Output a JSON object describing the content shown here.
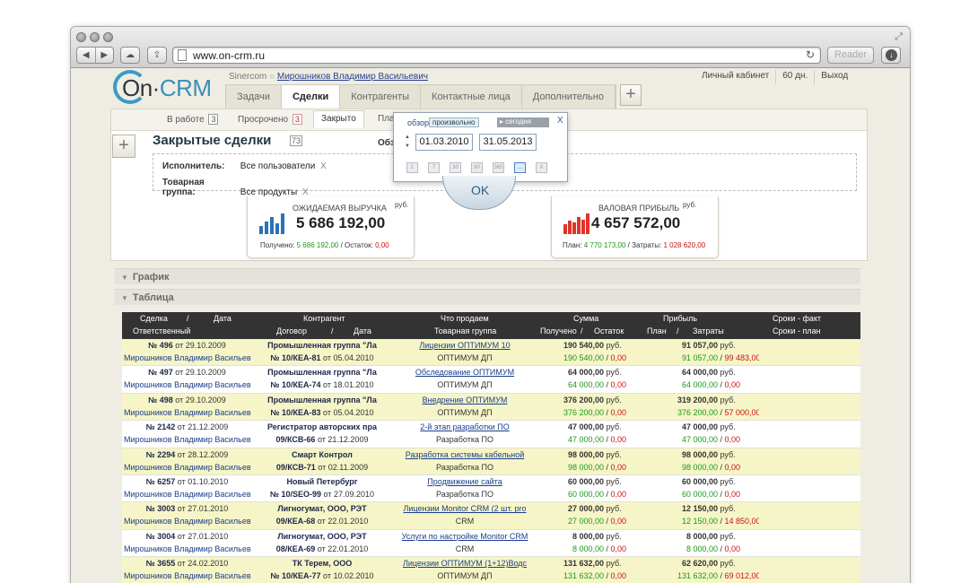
{
  "browser": {
    "url": "www.on-crm.ru",
    "reader_label": "Reader"
  },
  "app": {
    "logo_text": "On·CRM",
    "company": "Sinercom",
    "user_name": "Мирошников Владимир Васильевич",
    "right_links": [
      "Личный кабинет",
      "60 дн.",
      "Выход"
    ],
    "nav_tabs": [
      {
        "label": "Задачи",
        "active": false
      },
      {
        "label": "Сделки",
        "active": true
      },
      {
        "label": "Контрагенты",
        "active": false
      },
      {
        "label": "Контактные лица",
        "active": false
      },
      {
        "label": "Дополнительно",
        "active": false
      }
    ],
    "plus_label": "+"
  },
  "subtabs": [
    {
      "label": "В работе",
      "count": "3",
      "active": false,
      "red": false
    },
    {
      "label": "Просрочено",
      "count": "3",
      "active": false,
      "red": true
    },
    {
      "label": "Закрыто",
      "count": "",
      "active": true,
      "red": false
    },
    {
      "label": "Пла",
      "count": "",
      "active": false,
      "red": false
    }
  ],
  "page": {
    "title": "Закрытые сделки",
    "title_count": "73",
    "obzor_label": "Обз"
  },
  "filters": [
    {
      "label": "Исполнитель:",
      "value": "Все пользователи",
      "remove": "X"
    },
    {
      "label": "Товарная группа:",
      "value": "Все продукты",
      "remove": "X"
    }
  ],
  "date_picker": {
    "label": "обзор:",
    "mode": "произвольно",
    "today_label": "сегодня",
    "close_label": "X",
    "date_from": "01.03.2010",
    "date_to": "31.05.2013",
    "icons": [
      "1",
      "7",
      "30",
      "90",
      "365",
      "...",
      "X"
    ],
    "active_icon_index": 5,
    "ok_label": "OK"
  },
  "kpis": {
    "revenue": {
      "title": "ОЖИДАЕМАЯ ВЫРУЧКА",
      "currency": "руб.",
      "value": "5 686 192,00",
      "sub_label1": "Получено: ",
      "sub_value1": "5 686 192,00",
      "sub_label2": " / Остаток: ",
      "sub_value2": "0,00"
    },
    "profit": {
      "title": "ВАЛОВАЯ ПРИБЫЛЬ",
      "currency": "руб.",
      "value": "4 657 572,00",
      "sub_label1": "План: ",
      "sub_value1": "4 770 173,00",
      "sub_label2": " / Затраты: ",
      "sub_value2": "1 028 620,00"
    }
  },
  "sections": {
    "chart": "График",
    "table": "Таблица"
  },
  "table": {
    "header_row1": [
      "Сделка",
      "/",
      "Дата",
      "Контрагент",
      "Что продаем",
      "Сумма",
      "Прибыль",
      "Сроки - факт"
    ],
    "header_row2": [
      "Ответственный",
      "Договор",
      "/",
      "Дата",
      "Товарная группа",
      "Получено",
      "/",
      "Остаток",
      "План",
      "/",
      "Затраты",
      "Сроки - план"
    ],
    "rows": [
      {
        "deal": "№ 496",
        "date_prefix": "от",
        "date": "29.10.2009",
        "owner": "Мирошников Владимир Васильев",
        "client": "Промышленная группа \"Ла",
        "contract": "№ 10/КЕА-81",
        "contract_date_prefix": "от",
        "contract_date": "05.04.2010",
        "product": "Лицензии ОПТИМУМ 10",
        "group": "ОПТИМУМ ДП",
        "sum": "190 540,00",
        "received": "190 540,00",
        "remain": "0,00",
        "profit": "91 057,00",
        "plan": "91 057,00",
        "costs": "99 483,00",
        "currency": "руб."
      },
      {
        "deal": "№ 497",
        "date_prefix": "от",
        "date": "29.10.2009",
        "owner": "Мирошников Владимир Васильев",
        "client": "Промышленная группа \"Ла",
        "contract": "№ 10/КЕА-74",
        "contract_date_prefix": "от",
        "contract_date": "18.01.2010",
        "product": "Обследование ОПТИМУМ",
        "group": "ОПТИМУМ ДП",
        "sum": "64 000,00",
        "received": "64 000,00",
        "remain": "0,00",
        "profit": "64 000,00",
        "plan": "64 000,00",
        "costs": "0,00",
        "currency": "руб."
      },
      {
        "deal": "№ 498",
        "date_prefix": "от",
        "date": "29.10.2009",
        "owner": "Мирошников Владимир Васильев",
        "client": "Промышленная группа \"Ла",
        "contract": "№ 10/КЕА-83",
        "contract_date_prefix": "от",
        "contract_date": "05.04.2010",
        "product": "Внедрение ОПТИМУМ",
        "group": "ОПТИМУМ ДП",
        "sum": "376 200,00",
        "received": "376 200,00",
        "remain": "0,00",
        "profit": "319 200,00",
        "plan": "376 200,00",
        "costs": "57 000,00",
        "currency": "руб."
      },
      {
        "deal": "№ 2142",
        "date_prefix": "от",
        "date": "21.12.2009",
        "owner": "Мирошников Владимир Васильев",
        "client": "Регистратор авторских пра",
        "contract": "09/КСВ-66",
        "contract_date_prefix": "от",
        "contract_date": "21.12.2009",
        "product": "2-й этап разработки ПО",
        "group": "Разработка ПО",
        "sum": "47 000,00",
        "received": "47 000,00",
        "remain": "0,00",
        "profit": "47 000,00",
        "plan": "47 000,00",
        "costs": "0,00",
        "currency": "руб."
      },
      {
        "deal": "№ 2294",
        "date_prefix": "от",
        "date": "28.12.2009",
        "owner": "Мирошников Владимир Васильев",
        "client": "Смарт Контрол",
        "contract": "09/КСВ-71",
        "contract_date_prefix": "от",
        "contract_date": "02.11.2009",
        "product": "Разработка системы кабельной",
        "group": "Разработка ПО",
        "sum": "98 000,00",
        "received": "98 000,00",
        "remain": "0,00",
        "profit": "98 000,00",
        "plan": "98 000,00",
        "costs": "0,00",
        "currency": "руб."
      },
      {
        "deal": "№ 6257",
        "date_prefix": "от",
        "date": "01.10.2010",
        "owner": "Мирошников Владимир Васильев",
        "client": "Новый Петербург",
        "contract": "№ 10/SEO-99",
        "contract_date_prefix": "от",
        "contract_date": "27.09.2010",
        "product": "Продвижение сайта",
        "group": "Разработка ПО",
        "sum": "60 000,00",
        "received": "60 000,00",
        "remain": "0,00",
        "profit": "60 000,00",
        "plan": "60 000,00",
        "costs": "0,00",
        "currency": "руб."
      },
      {
        "deal": "№ 3003",
        "date_prefix": "от",
        "date": "27.01.2010",
        "owner": "Мирошников Владимир Васильев",
        "client": "Лигногумат, ООО, РЭТ",
        "contract": "09/КЕА-68",
        "contract_date_prefix": "от",
        "contract_date": "22.01.2010",
        "product": "Лицензии Monitor CRM (2 шт. pro",
        "group": "CRM",
        "sum": "27 000,00",
        "received": "27 000,00",
        "remain": "0,00",
        "profit": "12 150,00",
        "plan": "12 150,00",
        "costs": "14 850,00",
        "currency": "руб."
      },
      {
        "deal": "№ 3004",
        "date_prefix": "от",
        "date": "27.01.2010",
        "owner": "Мирошников Владимир Васильев",
        "client": "Лигногумат, ООО, РЭТ",
        "contract": "08/КЕА-69",
        "contract_date_prefix": "от",
        "contract_date": "22.01.2010",
        "product": "Услуги по настройке Monitor CRM",
        "group": "CRM",
        "sum": "8 000,00",
        "received": "8 000,00",
        "remain": "0,00",
        "profit": "8 000,00",
        "plan": "8 000,00",
        "costs": "0,00",
        "currency": "руб."
      },
      {
        "deal": "№ 3655",
        "date_prefix": "от",
        "date": "24.02.2010",
        "owner": "Мирошников Владимир Васильев",
        "client": "ТК Терем, ООО",
        "contract": "№ 10/КЕА-77",
        "contract_date_prefix": "от",
        "contract_date": "10.02.2010",
        "product": "Лицензии ОПТИМУМ (1+12)Водс",
        "group": "ОПТИМУМ ДП",
        "sum": "131 632,00",
        "received": "131 632,00",
        "remain": "0,00",
        "profit": "62 620,00",
        "plan": "131 632,00",
        "costs": "69 012,00",
        "currency": "руб."
      }
    ]
  },
  "colors": {
    "accent_blue": "#1a3e8a",
    "row_highlight": "#f6f5c7",
    "header_dark": "#333333",
    "positive": "#1b9a1b",
    "negative": "#c81414",
    "revenue_bars": "#2d71b8",
    "profit_bars": "#e0342a"
  }
}
